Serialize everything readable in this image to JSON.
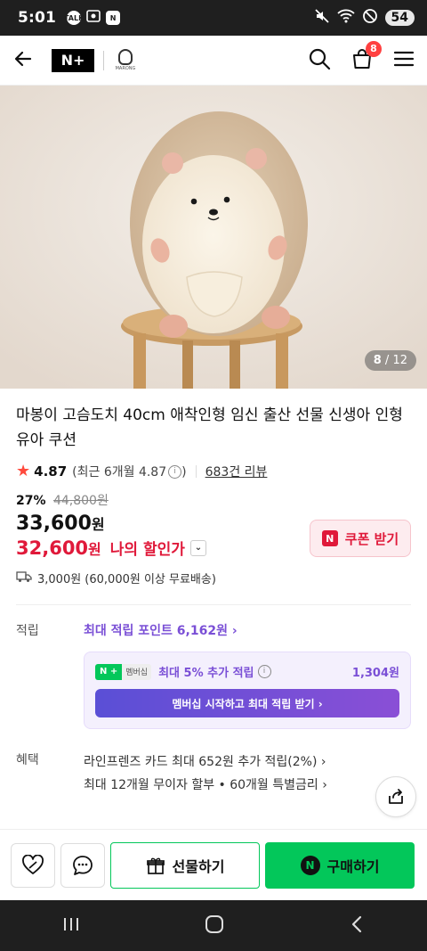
{
  "status": {
    "time": "5:01",
    "battery": "54",
    "talk_icon": "TALK",
    "n_icon": "N"
  },
  "appbar": {
    "logo": "N+",
    "brand_logo_text": "MARONG",
    "cart_count": "8"
  },
  "hero": {
    "counter_current": "8",
    "counter_sep": " / ",
    "counter_total": "12"
  },
  "product": {
    "title": "마봉이 고슴도치 40cm 애착인형 임신 출산 선물 신생아 인형 유아 쿠션",
    "rating": "4.87",
    "recent_open": "(최근 6개월 4.87",
    "recent_close": ")",
    "review_count": "683건 리뷰",
    "discount_rate": "27%",
    "original_price": "44,800원",
    "price": "33,600",
    "price_unit": "원",
    "my_price": "32,600",
    "my_price_unit": "원",
    "my_price_label": "나의 할인가",
    "coupon_label": "쿠폰 받기",
    "shipping": "3,000원 (60,000원 이상 무료배송)"
  },
  "points": {
    "label": "적립",
    "max": "최대 적립 포인트 6,162원 ›",
    "badge_np": "N +",
    "badge_membership": "멤버십",
    "extra": "최대 5% 추가 적립",
    "extra_points": "1,304원",
    "cta": "멤버십 시작하고 최대 적립 받기 ›"
  },
  "benefits": {
    "label": "혜택",
    "line1": "라인프렌즈 카드 최대 652원 추가 적립(2%) ›",
    "line2": "최대 12개월 무이자 할부 • 60개월 특별금리 ›"
  },
  "bottom": {
    "gift_label": "선물하기",
    "buy_label": "구매하기",
    "n_mark": "N"
  },
  "colors": {
    "accent_green": "#03c75a",
    "price_red": "#e0193a",
    "member_purple": "#7a4fd6"
  }
}
